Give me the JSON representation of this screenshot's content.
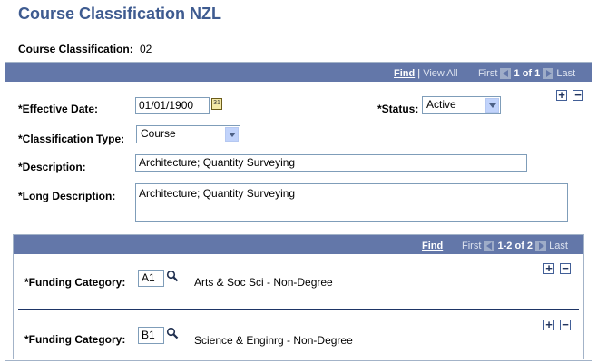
{
  "page": {
    "title": "Course Classification NZL",
    "course_classification_label": "Course Classification:",
    "course_classification_value": "02"
  },
  "outer_nav": {
    "find": "Find",
    "separator": "|",
    "view_all": "View All",
    "first": "First",
    "count": "1 of 1",
    "last": "Last"
  },
  "form": {
    "effective_date_label": "*Effective Date:",
    "effective_date_value": "01/01/1900",
    "calendar_icon_text": "31",
    "status_label": "*Status:",
    "status_value": "Active",
    "classification_type_label": "*Classification Type:",
    "classification_type_value": "Course",
    "description_label": "*Description:",
    "description_value": "Architecture; Quantity Surveying",
    "long_description_label": "*Long Description:",
    "long_description_value": "Architecture; Quantity Surveying"
  },
  "inner_nav": {
    "find": "Find",
    "first": "First",
    "count": "1-2 of 2",
    "last": "Last"
  },
  "funding_rows": [
    {
      "label": "*Funding Category:",
      "code": "A1",
      "description": "Arts & Soc Sci  - Non-Degree"
    },
    {
      "label": "*Funding Category:",
      "code": "B1",
      "description": "Science & Enginrg - Non-Degree"
    }
  ],
  "buttons": {
    "add": "+",
    "remove": "−"
  },
  "icons": {
    "calendar": "calendar-icon",
    "lookup": "magnifier-icon",
    "dropdown": "chevron-down-icon",
    "prev": "prev-arrow-icon",
    "next": "next-arrow-icon"
  },
  "colors": {
    "title": "#3e5b90",
    "bar": "#6377a9",
    "border": "#a3b3c8",
    "divider": "#1e3566"
  }
}
